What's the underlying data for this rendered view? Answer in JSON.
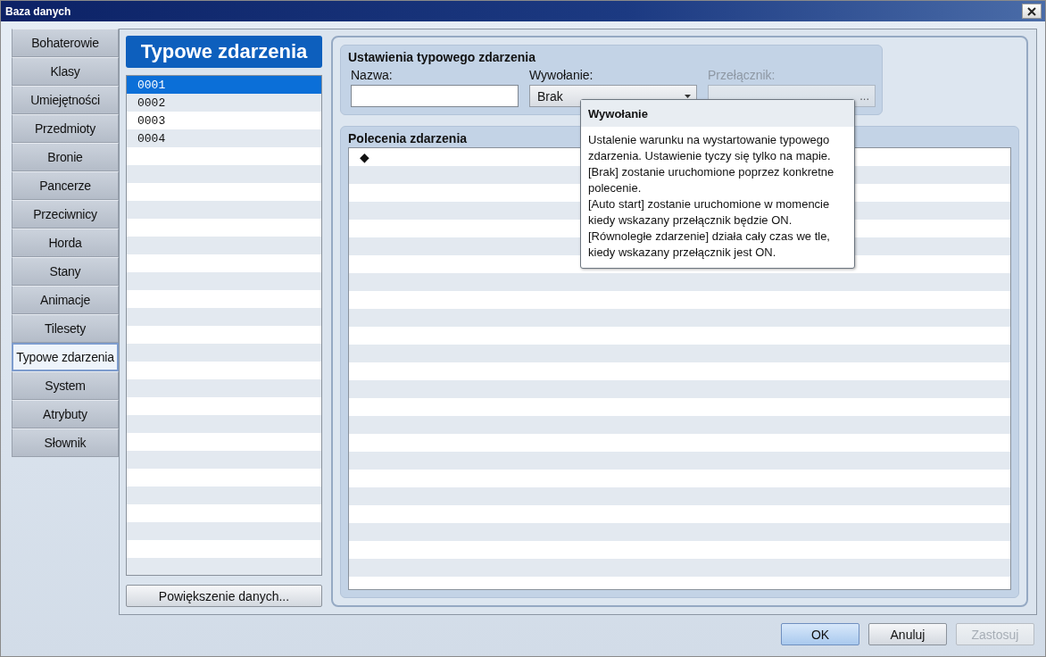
{
  "window": {
    "title": "Baza danych"
  },
  "tabs": [
    {
      "label": "Bohaterowie",
      "selected": false
    },
    {
      "label": "Klasy",
      "selected": false
    },
    {
      "label": "Umiejętności",
      "selected": false
    },
    {
      "label": "Przedmioty",
      "selected": false
    },
    {
      "label": "Bronie",
      "selected": false
    },
    {
      "label": "Pancerze",
      "selected": false
    },
    {
      "label": "Przeciwnicy",
      "selected": false
    },
    {
      "label": "Horda",
      "selected": false
    },
    {
      "label": "Stany",
      "selected": false
    },
    {
      "label": "Animacje",
      "selected": false
    },
    {
      "label": "Tilesety",
      "selected": false
    },
    {
      "label": "Typowe zdarzenia",
      "selected": true
    },
    {
      "label": "System",
      "selected": false
    },
    {
      "label": "Atrybuty",
      "selected": false
    },
    {
      "label": "Słownik",
      "selected": false
    }
  ],
  "list": {
    "title": "Typowe zdarzenia",
    "items": [
      {
        "label": "0001",
        "selected": true
      },
      {
        "label": "0002",
        "selected": false
      },
      {
        "label": "0003",
        "selected": false
      },
      {
        "label": "0004",
        "selected": false
      }
    ],
    "button": "Powiększenie danych..."
  },
  "settings": {
    "title": "Ustawienia typowego zdarzenia",
    "name": {
      "label": "Nazwa:"
    },
    "trigger": {
      "label": "Wywołanie:",
      "value": "Brak"
    },
    "switch": {
      "label": "Przełącznik:",
      "disabled": true,
      "button": "..."
    }
  },
  "commands": {
    "title": "Polecenia zdarzenia",
    "rows": [
      "◆"
    ]
  },
  "tooltip": {
    "title": "Wywołanie",
    "paragraphs": [
      "Ustalenie warunku na wystartowanie typowego zdarzenia. Ustawienie tyczy się tylko na mapie.",
      "[Brak] zostanie uruchomione poprzez konkretne polecenie.",
      "[Auto start] zostanie uruchomione w momencie kiedy wskazany przełącznik będzie ON.",
      "[Równoległe zdarzenie] działa cały czas we tle, kiedy wskazany przełącznik jest ON."
    ]
  },
  "buttons": [
    {
      "label": "OK",
      "default": true,
      "disabled": false
    },
    {
      "label": "Anuluj",
      "default": false,
      "disabled": false
    },
    {
      "label": "Zastosuj",
      "default": false,
      "disabled": true
    }
  ]
}
